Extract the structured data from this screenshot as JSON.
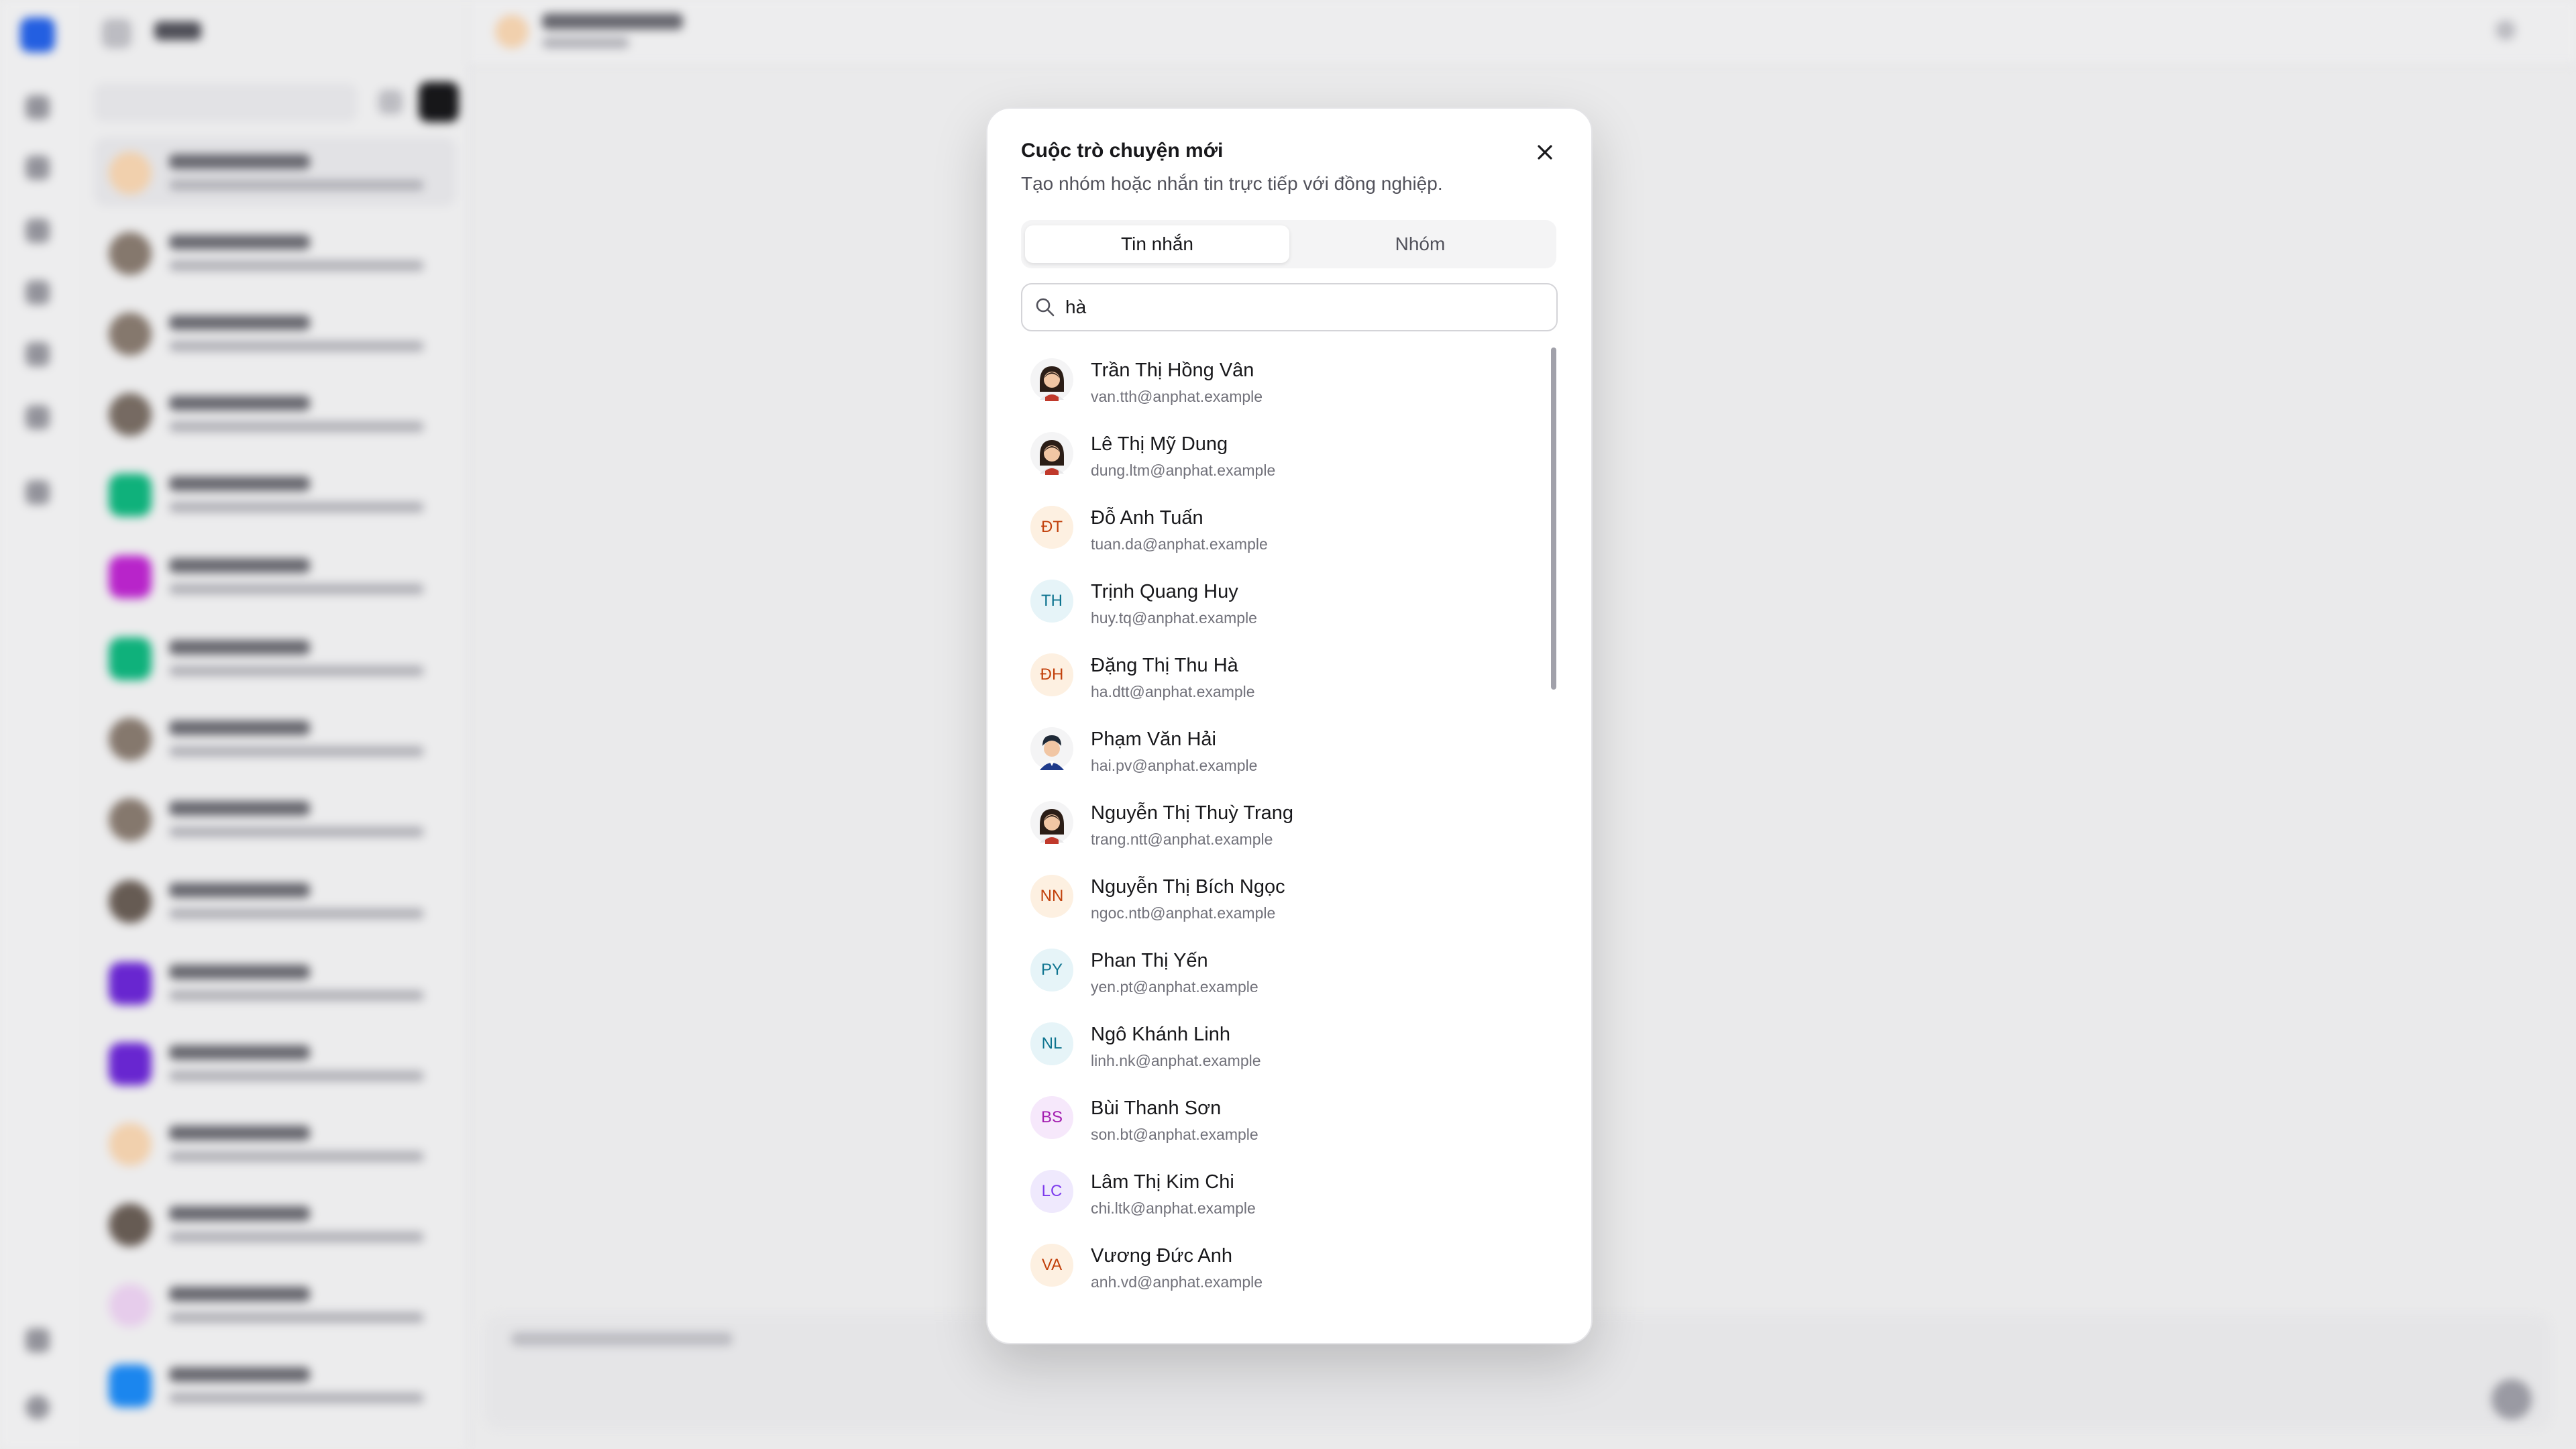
{
  "modal": {
    "title": "Cuộc trò chuyện mới",
    "subtitle": "Tạo nhóm hoặc nhắn tin trực tiếp với đồng nghiệp.",
    "close_icon": "close-icon",
    "tabs": [
      {
        "label": "Tin nhắn",
        "active": true
      },
      {
        "label": "Nhóm",
        "active": false
      }
    ],
    "search": {
      "value": "hà",
      "icon": "search-icon"
    },
    "contacts": [
      {
        "name": "Trần Thị Hồng Vân",
        "email": "van.tth@anphat.example",
        "avatar": "photo-woman"
      },
      {
        "name": "Lê Thị Mỹ Dung",
        "email": "dung.ltm@anphat.example",
        "avatar": "photo-woman"
      },
      {
        "name": "Đỗ Anh Tuấn",
        "email": "tuan.da@anphat.example",
        "initials": "ĐT",
        "bg": "#fdf0e1",
        "fg": "#c2410c"
      },
      {
        "name": "Trịnh Quang Huy",
        "email": "huy.tq@anphat.example",
        "initials": "TH",
        "bg": "#e6f4f8",
        "fg": "#0e7490"
      },
      {
        "name": "Đặng Thị Thu Hà",
        "email": "ha.dtt@anphat.example",
        "initials": "ĐH",
        "bg": "#fdf0e1",
        "fg": "#c2410c"
      },
      {
        "name": "Phạm Văn Hải",
        "email": "hai.pv@anphat.example",
        "avatar": "photo-man"
      },
      {
        "name": "Nguyễn Thị Thuỳ Trang",
        "email": "trang.ntt@anphat.example",
        "avatar": "photo-woman"
      },
      {
        "name": "Nguyễn Thị Bích Ngọc",
        "email": "ngoc.ntb@anphat.example",
        "initials": "NN",
        "bg": "#fdf0e1",
        "fg": "#c2410c"
      },
      {
        "name": "Phan Thị Yến",
        "email": "yen.pt@anphat.example",
        "initials": "PY",
        "bg": "#e6f4f8",
        "fg": "#0e7490"
      },
      {
        "name": "Ngô Khánh Linh",
        "email": "linh.nk@anphat.example",
        "initials": "NL",
        "bg": "#e6f4f8",
        "fg": "#0e7490"
      },
      {
        "name": "Bùi Thanh Sơn",
        "email": "son.bt@anphat.example",
        "initials": "BS",
        "bg": "#f6e8fb",
        "fg": "#a21caf"
      },
      {
        "name": "Lâm Thị Kim Chi",
        "email": "chi.ltk@anphat.example",
        "initials": "LC",
        "bg": "#efe9fd",
        "fg": "#7c3aed"
      },
      {
        "name": "Vương Đức Anh",
        "email": "anh.vd@anphat.example",
        "initials": "VA",
        "bg": "#fdf0e1",
        "fg": "#c2410c"
      }
    ]
  },
  "colors": {
    "accent": "#2563eb",
    "primary_dark": "#18181b",
    "scrollbar": "#a1a1aa"
  }
}
